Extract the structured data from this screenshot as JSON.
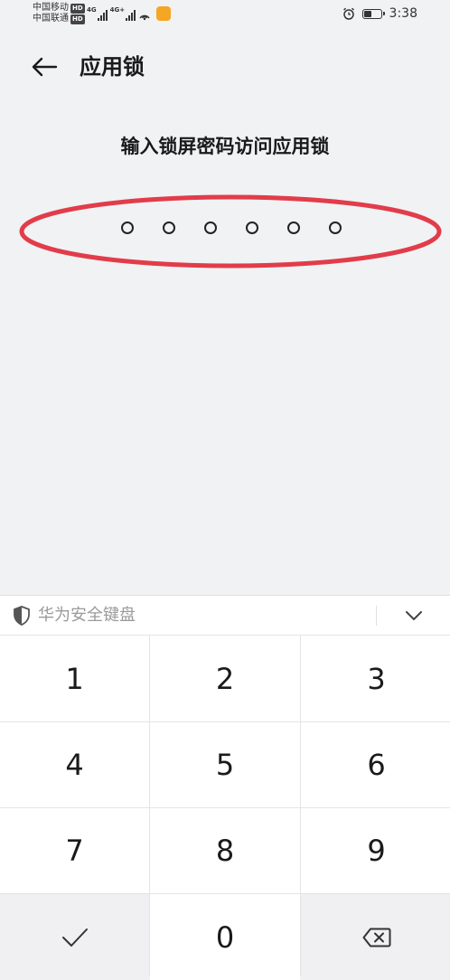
{
  "status_bar": {
    "carrier1": "中国移动",
    "carrier2": "中国联通",
    "hd_badge": "HD",
    "net1": "4G",
    "net2": "4G+",
    "time": "3:38"
  },
  "header": {
    "title": "应用锁"
  },
  "prompt": {
    "text": "输入锁屏密码访问应用锁"
  },
  "pin": {
    "length": 6,
    "entered": 0
  },
  "keyboard": {
    "brand": "华为安全键盘",
    "keys": {
      "k1": "1",
      "k2": "2",
      "k3": "3",
      "k4": "4",
      "k5": "5",
      "k6": "6",
      "k7": "7",
      "k8": "8",
      "k9": "9",
      "k0": "0"
    }
  },
  "colors": {
    "annotation_ellipse": "#e23c4a",
    "background": "#f1f2f4"
  }
}
